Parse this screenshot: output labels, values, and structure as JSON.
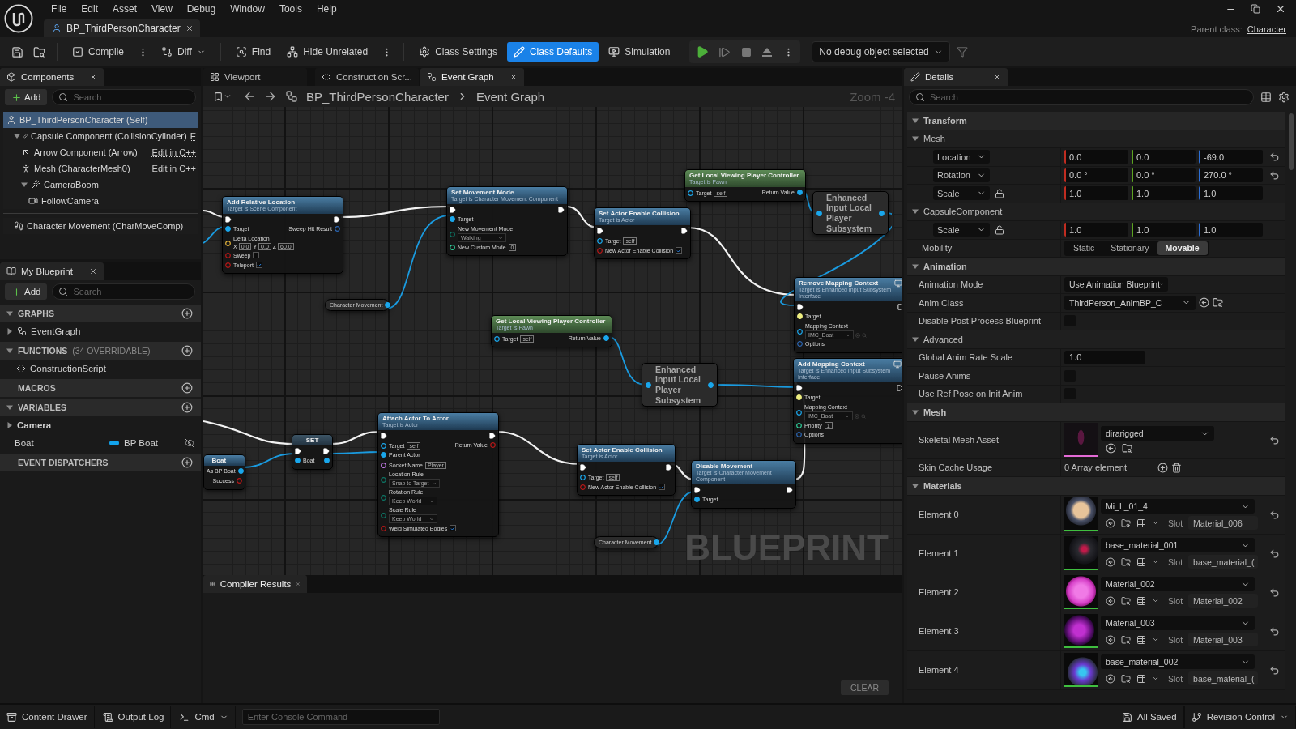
{
  "app": {
    "menu": [
      "File",
      "Edit",
      "Asset",
      "View",
      "Debug",
      "Window",
      "Tools",
      "Help"
    ],
    "document_tab": {
      "title": "BP_ThirdPersonCharacter"
    },
    "parent_class": {
      "label": "Parent class:",
      "value": "Character"
    }
  },
  "toolbar": {
    "buttons": [
      {
        "label": "Compile",
        "selected": false,
        "dropdown": false
      },
      {
        "label": "Diff",
        "selected": false,
        "dropdown": true
      },
      {
        "label": "Find",
        "selected": false,
        "dropdown": false
      },
      {
        "label": "Hide Unrelated",
        "selected": false,
        "dropdown": false
      },
      {
        "label": "Class Settings",
        "selected": false,
        "dropdown": false
      },
      {
        "label": "Class Defaults",
        "selected": true,
        "dropdown": false
      },
      {
        "label": "Simulation",
        "selected": false,
        "dropdown": false
      }
    ],
    "debug_filter": {
      "value": "No debug object selected"
    }
  },
  "components": {
    "title": "Components",
    "add_label": "Add",
    "search": {
      "placeholder": "Search"
    },
    "tree": [
      {
        "kind": "actor",
        "label": "BP_ThirdPersonCharacter (Self)",
        "selected": true,
        "children": [
          {
            "kind": "capsule",
            "label": "Capsule Component (CollisionCylinder)",
            "link": "E",
            "selected": false,
            "expanded": true,
            "children": [
              {
                "kind": "arrow",
                "label": "Arrow Component (Arrow)",
                "link": "Edit in C++",
                "selected": false
              },
              {
                "kind": "mesh",
                "label": "Mesh (CharacterMesh0)",
                "link": "Edit in C++",
                "selected": false
              },
              {
                "kind": "boom",
                "label": "CameraBoom",
                "selected": false,
                "expanded": true,
                "children": [
                  {
                    "kind": "camera",
                    "label": "FollowCamera",
                    "selected": false
                  }
                ]
              }
            ]
          }
        ]
      }
    ],
    "other": [
      {
        "kind": "movement",
        "label": "Character Movement (CharMoveComp)",
        "selected": false
      }
    ]
  },
  "my_blueprint": {
    "title": "My Blueprint",
    "add_label": "Add",
    "search": {
      "placeholder": "Search"
    },
    "sections": [
      {
        "label": "GRAPHS",
        "expanded": true,
        "items": [
          {
            "kind": "graph",
            "label": "EventGraph",
            "expanded": false
          }
        ]
      },
      {
        "label": "FUNCTIONS",
        "note": "(34 OVERRIDABLE)",
        "expanded": true,
        "items": [
          {
            "kind": "function",
            "label": "ConstructionScript"
          }
        ]
      },
      {
        "label": "MACROS"
      },
      {
        "label": "VARIABLES",
        "expanded": true,
        "items": [
          {
            "kind": "category",
            "label": "Camera",
            "expanded": false
          },
          {
            "kind": "variable",
            "label": "Boat",
            "type": "BP Boat",
            "color": "#12a3ec"
          }
        ]
      },
      {
        "label": "EVENT DISPATCHERS"
      }
    ]
  },
  "editor_tabs": [
    {
      "label": "Viewport",
      "selected": false,
      "closable": false
    },
    {
      "label": "Construction Scr...",
      "selected": false,
      "closable": false
    },
    {
      "label": "Event Graph",
      "selected": true,
      "closable": true
    }
  ],
  "graph": {
    "breadcrumb": [
      "BP_ThirdPersonCharacter",
      "Event Graph"
    ],
    "zoom_label": "Zoom -4",
    "watermark": "BLUEPRINT",
    "nodes": [
      {
        "kind": "function",
        "title": "Add Relative Location",
        "subtitle": "Target is Scene Component",
        "client_only": false,
        "rows": [
          {
            "in": {
              "kind": "exec",
              "linked": true
            },
            "out": {
              "kind": "exec",
              "linked": true
            }
          },
          {
            "in": {
              "kind": "object",
              "label": "Target",
              "linked": true
            },
            "out": {
              "kind": "struct",
              "label": "Sweep Hit Result",
              "linked": false
            }
          },
          {
            "in": {
              "kind": "vector",
              "label": "Delta Location",
              "linked": false,
              "axes": [
                {
                  "axis": "X",
                  "value": "0.0"
                },
                {
                  "axis": "Y",
                  "value": "0.0"
                },
                {
                  "axis": "Z",
                  "value": "60.0"
                }
              ]
            }
          },
          {
            "in": {
              "kind": "bool",
              "label": "Sweep",
              "linked": false,
              "checked": false
            }
          },
          {
            "in": {
              "kind": "bool",
              "label": "Teleport",
              "linked": false,
              "checked": true
            }
          }
        ]
      },
      {
        "kind": "function",
        "title": "Set Movement Mode",
        "subtitle": "Target is Character Movement Component",
        "client_only": false,
        "rows": [
          {
            "in": {
              "kind": "exec",
              "linked": true
            },
            "out": {
              "kind": "exec",
              "linked": true
            }
          },
          {
            "in": {
              "kind": "object",
              "label": "Target",
              "linked": true
            }
          },
          {
            "in": {
              "kind": "byte",
              "label": "New Movement Mode",
              "linked": false,
              "value": "Walking"
            }
          },
          {
            "in": {
              "kind": "int",
              "label": "New Custom Mode",
              "linked": false,
              "value": "0"
            }
          }
        ]
      },
      {
        "kind": "function",
        "title": "Set Actor Enable Collision",
        "subtitle": "Target is Actor",
        "client_only": false,
        "rows": [
          {
            "in": {
              "kind": "exec",
              "linked": true
            },
            "out": {
              "kind": "exec",
              "linked": true
            }
          },
          {
            "in": {
              "kind": "object",
              "label": "Target",
              "linked": false,
              "value": "self"
            }
          },
          {
            "in": {
              "kind": "bool",
              "label": "New Actor Enable Collision",
              "linked": false,
              "checked": true
            }
          }
        ]
      },
      {
        "kind": "pure",
        "title": "Get Local Viewing Player Controller",
        "subtitle": "Target is Pawn",
        "client_only": false,
        "rows": [
          {
            "in": {
              "kind": "object",
              "label": "Target",
              "linked": false,
              "value": "self"
            },
            "out": {
              "kind": "object",
              "label": "Return Value",
              "linked": true
            }
          }
        ]
      },
      {
        "kind": "compact",
        "title": "Enhanced Input Local Player Subsystem",
        "client_only": false,
        "rows": [
          {
            "in": {
              "kind": "object",
              "linked": true
            },
            "out": {
              "kind": "object",
              "linked": true
            }
          }
        ]
      },
      {
        "kind": "function",
        "title": "Remove Mapping Context",
        "subtitle": "Target is Enhanced Input Subsystem Interface",
        "client_only": true,
        "rows": [
          {
            "in": {
              "kind": "exec",
              "linked": true
            },
            "out": {
              "kind": "exec",
              "linked": false
            }
          },
          {
            "in": {
              "kind": "interface",
              "label": "Target",
              "linked": true
            }
          },
          {
            "in": {
              "kind": "asset",
              "label": "Mapping Context",
              "linked": false,
              "value": "IMC_Boat"
            }
          },
          {
            "in": {
              "kind": "struct",
              "label": "Options",
              "linked": false
            }
          }
        ]
      },
      {
        "kind": "getter",
        "title": "Character Movement",
        "client_only": false,
        "rows": [
          {
            "out": {
              "kind": "object",
              "linked": true
            }
          }
        ]
      },
      {
        "kind": "pure",
        "title": "Get Local Viewing Player Controller",
        "subtitle": "Target is Pawn",
        "client_only": false,
        "rows": [
          {
            "in": {
              "kind": "object",
              "label": "Target",
              "linked": false,
              "value": "self"
            },
            "out": {
              "kind": "object",
              "label": "Return Value",
              "linked": true
            }
          }
        ]
      },
      {
        "kind": "compact",
        "title": "Enhanced Input Local Player Subsystem",
        "client_only": false,
        "rows": [
          {
            "in": {
              "kind": "object",
              "linked": true
            },
            "out": {
              "kind": "object",
              "linked": true
            }
          }
        ]
      },
      {
        "kind": "function",
        "title": "Add Mapping Context",
        "subtitle": "Target is Enhanced Input Subsystem Interface",
        "client_only": true,
        "rows": [
          {
            "in": {
              "kind": "exec",
              "linked": true
            },
            "out": {
              "kind": "exec",
              "linked": false
            }
          },
          {
            "in": {
              "kind": "interface",
              "label": "Target",
              "linked": true
            }
          },
          {
            "in": {
              "kind": "asset",
              "label": "Mapping Context",
              "linked": false,
              "value": "IMC_Boat"
            }
          },
          {
            "in": {
              "kind": "int",
              "label": "Priority",
              "linked": false,
              "value": "1"
            }
          },
          {
            "in": {
              "kind": "struct",
              "label": "Options",
              "linked": false
            }
          }
        ]
      },
      {
        "kind": "function",
        "title": "_Boat",
        "client_only": false,
        "rows": [
          {
            "out": {
              "kind": "object",
              "label": "As BP Boat",
              "linked": true
            }
          },
          {
            "out": {
              "kind": "bool",
              "label": "Success",
              "linked": false
            }
          }
        ]
      },
      {
        "kind": "set",
        "title": "SET",
        "client_only": false,
        "rows": [
          {
            "in": {
              "kind": "exec",
              "linked": true
            },
            "out": {
              "kind": "exec",
              "linked": true
            }
          },
          {
            "in": {
              "kind": "object",
              "label": "Boat",
              "linked": true
            },
            "out": {
              "kind": "object",
              "linked": true
            }
          }
        ]
      },
      {
        "kind": "function",
        "title": "Attach Actor To Actor",
        "subtitle": "Target is Actor",
        "client_only": false,
        "rows": [
          {
            "in": {
              "kind": "exec",
              "linked": true
            },
            "out": {
              "kind": "exec",
              "linked": true
            }
          },
          {
            "in": {
              "kind": "object",
              "label": "Target",
              "linked": false,
              "value": "self"
            },
            "out": {
              "kind": "bool",
              "label": "Return Value",
              "linked": false
            }
          },
          {
            "in": {
              "kind": "object",
              "label": "Parent Actor",
              "linked": true
            }
          },
          {
            "in": {
              "kind": "name",
              "label": "Socket Name",
              "linked": false,
              "value": "Player"
            }
          },
          {
            "in": {
              "kind": "byte",
              "label": "Location Rule",
              "linked": false,
              "value": "Snap to Target"
            }
          },
          {
            "in": {
              "kind": "byte",
              "label": "Rotation Rule",
              "linked": false,
              "value": "Keep World"
            }
          },
          {
            "in": {
              "kind": "byte",
              "label": "Scale Rule",
              "linked": false,
              "value": "Keep World"
            }
          },
          {
            "in": {
              "kind": "bool",
              "label": "Weld Simulated Bodies",
              "linked": false,
              "checked": true
            }
          }
        ]
      },
      {
        "kind": "function",
        "title": "Set Actor Enable Collision",
        "subtitle": "Target is Actor",
        "client_only": false,
        "rows": [
          {
            "in": {
              "kind": "exec",
              "linked": true
            },
            "out": {
              "kind": "exec",
              "linked": true
            }
          },
          {
            "in": {
              "kind": "object",
              "label": "Target",
              "linked": false,
              "value": "self"
            }
          },
          {
            "in": {
              "kind": "bool",
              "label": "New Actor Enable Collision",
              "linked": false,
              "checked": true
            }
          }
        ]
      },
      {
        "kind": "function",
        "title": "Disable Movement",
        "subtitle": "Target is Character Movement Component",
        "client_only": false,
        "rows": [
          {
            "in": {
              "kind": "exec",
              "linked": true
            },
            "out": {
              "kind": "exec",
              "linked": true
            }
          },
          {
            "in": {
              "kind": "object",
              "label": "Target",
              "linked": true
            }
          }
        ]
      },
      {
        "kind": "getter",
        "title": "Character Movement",
        "client_only": false,
        "rows": [
          {
            "out": {
              "kind": "object",
              "linked": true
            }
          }
        ]
      }
    ]
  },
  "compiler_results": {
    "title": "Compiler Results",
    "clear_label": "CLEAR"
  },
  "details": {
    "title": "Details",
    "search": {
      "placeholder": "Search"
    },
    "rows": [
      {
        "kind": "section",
        "label": "Transform",
        "expanded": true
      },
      {
        "kind": "subsection",
        "label": "Mesh",
        "expanded": true
      },
      {
        "kind": "vector",
        "label": "Location",
        "values": [
          "0.0",
          "0.0",
          "-69.0"
        ],
        "modified": true
      },
      {
        "kind": "vector",
        "label": "Rotation",
        "values": [
          "0.0 °",
          "0.0 °",
          "270.0 °"
        ],
        "modified": true
      },
      {
        "kind": "vector",
        "label": "Scale",
        "values": [
          "1.0",
          "1.0",
          "1.0"
        ],
        "modified": false,
        "locked": false
      },
      {
        "kind": "subsection",
        "label": "CapsuleComponent",
        "expanded": true
      },
      {
        "kind": "vector",
        "label": "Scale",
        "values": [
          "1.0",
          "1.0",
          "1.0"
        ],
        "modified": false,
        "locked": false
      },
      {
        "kind": "segmented",
        "label": "Mobility",
        "options": [
          {
            "label": "Static",
            "selected": false
          },
          {
            "label": "Stationary",
            "selected": false
          },
          {
            "label": "Movable",
            "selected": true
          }
        ]
      },
      {
        "kind": "section",
        "label": "Animation",
        "expanded": true
      },
      {
        "kind": "dropdown",
        "label": "Animation Mode",
        "value": "Use Animation Blueprint"
      },
      {
        "kind": "class",
        "label": "Anim Class",
        "value": "ThirdPerson_AnimBP_C"
      },
      {
        "kind": "checkbox",
        "label": "Disable Post Process Blueprint",
        "checked": false
      },
      {
        "kind": "subsection",
        "label": "Advanced",
        "expanded": true
      },
      {
        "kind": "number",
        "label": "Global Anim Rate Scale",
        "value": "1.0"
      },
      {
        "kind": "checkbox",
        "label": "Pause Anims",
        "checked": false
      },
      {
        "kind": "checkbox",
        "label": "Use Ref Pose on Init Anim",
        "checked": false
      },
      {
        "kind": "section",
        "label": "Mesh",
        "expanded": true
      },
      {
        "kind": "asset",
        "label": "Skeletal Mesh Asset",
        "value": "dirarigged",
        "modified": true
      },
      {
        "kind": "array",
        "label": "Skin Cache Usage",
        "value": "0 Array element"
      },
      {
        "kind": "section",
        "label": "Materials",
        "expanded": true
      },
      {
        "kind": "material",
        "label": "Element 0",
        "value": "Mi_L_01_4",
        "slot_label": "Slot",
        "slot": "Material_006",
        "modified": true
      },
      {
        "kind": "material",
        "label": "Element 1",
        "value": "base_material_001",
        "slot_label": "Slot",
        "slot": "base_material_(",
        "modified": true
      },
      {
        "kind": "material",
        "label": "Element 2",
        "value": "Material_002",
        "slot_label": "Slot",
        "slot": "Material_002",
        "modified": true
      },
      {
        "kind": "material",
        "label": "Element 3",
        "value": "Material_003",
        "slot_label": "Slot",
        "slot": "Material_003",
        "modified": true
      },
      {
        "kind": "material",
        "label": "Element 4",
        "value": "base_material_002",
        "slot_label": "Slot",
        "slot": "base_material_(",
        "modified": true
      }
    ]
  },
  "status_bar": {
    "left": [
      {
        "label": "Content Drawer",
        "dropdown": false
      },
      {
        "label": "Output Log",
        "dropdown": false
      },
      {
        "label": "Cmd",
        "dropdown": true
      }
    ],
    "console": {
      "placeholder": "Enter Console Command"
    },
    "right": [
      {
        "label": "All Saved",
        "dropdown": false
      },
      {
        "label": "Revision Control",
        "dropdown": true
      }
    ]
  }
}
